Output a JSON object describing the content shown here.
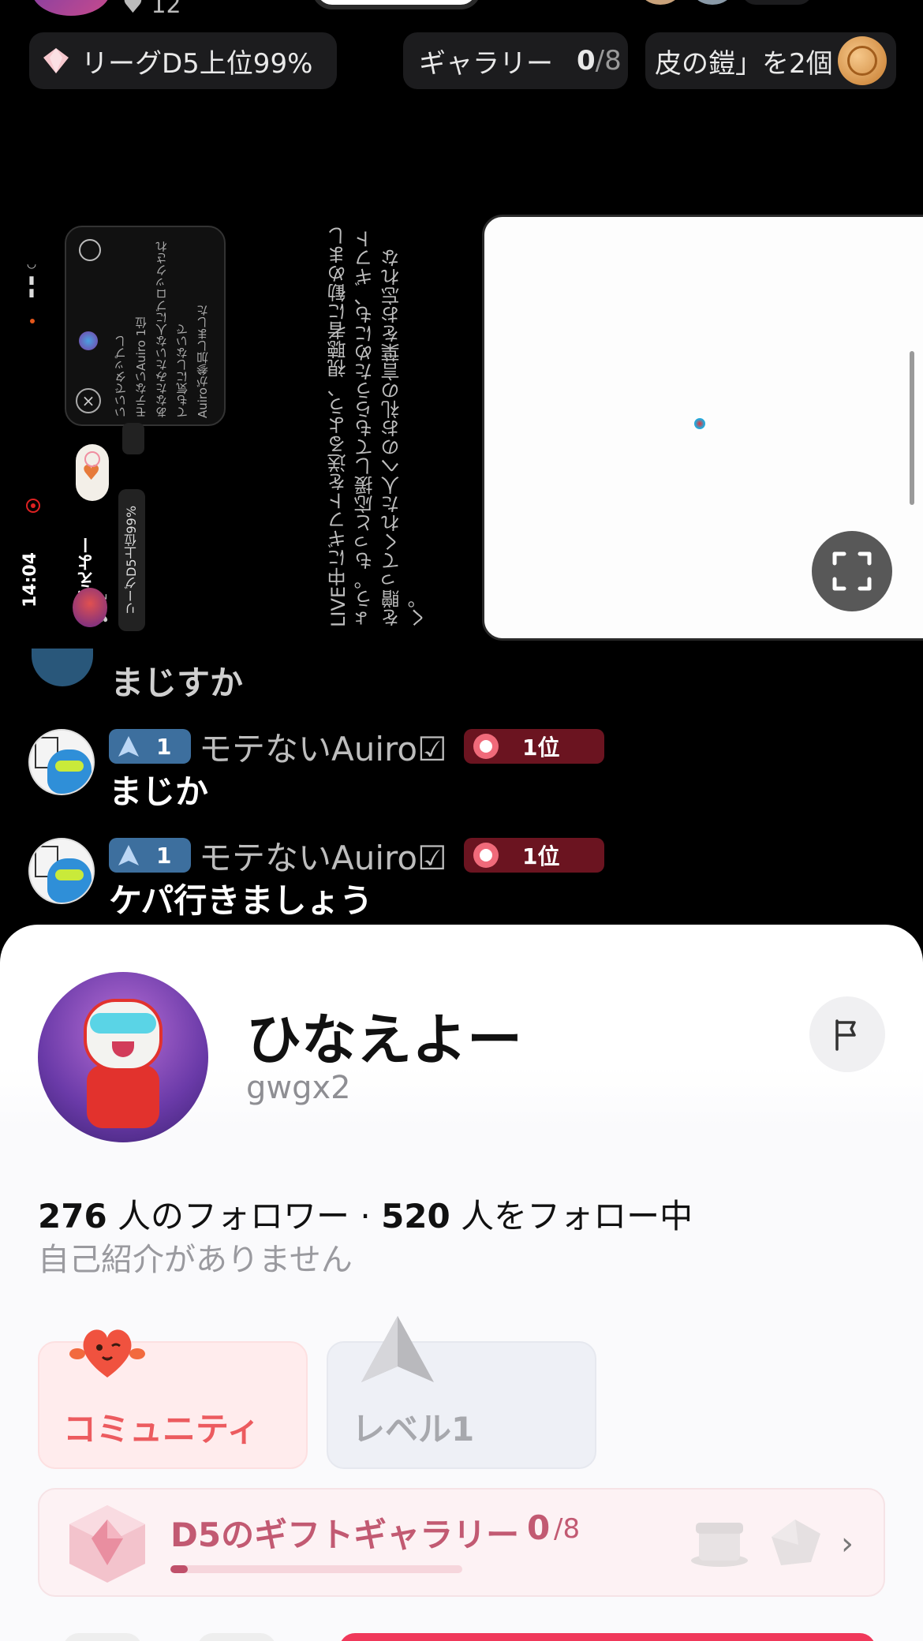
{
  "top": {
    "follower_count_cut": "12",
    "league_chip": "リーグD5上位99%",
    "gallery_chip_label": "ギャラリー",
    "gallery_chip_count": "0",
    "gallery_chip_total": "/8",
    "gift_chip": "皮の鎧」を2個"
  },
  "embedded_screenshot": {
    "time": "14:04",
    "host_name": "ひなえよー",
    "host_likes": "♥ 12",
    "league": "リーグD5上位99%",
    "panel_lines": [
      "いいでタップし",
      "モテないAuiro 1位",
      "あなたみたいな人にブロックされ",
      "ても気にしないで",
      "Auiroが参加しました"
    ],
    "notice": "LIVE中にギフトを送るよう、視聴者に勧めましょう。もっと応援してもらうためにも、ギフトを贈ってくれた人へのお礼の言葉をお忘れなく。"
  },
  "chat": {
    "cut_message": "まじすか",
    "messages": [
      {
        "level": "1",
        "user": "モテないAuiro☑",
        "rank": "1位",
        "text": "まじか"
      },
      {
        "level": "1",
        "user": "モテないAuiro☑",
        "rank": "1位",
        "text": "ケパ行きましょう"
      }
    ]
  },
  "profile": {
    "name": "ひなえよー",
    "handle": "gwgx2",
    "followers": "276",
    "followers_label": " 人のフォロワー · ",
    "following": "520",
    "following_label": " 人をフォロー中",
    "bio": "自己紹介がありません",
    "community_label": "コミュニティ",
    "level_label": "レベル1",
    "gallery_title": "D5のギフトギャラリー",
    "gallery_count": "0",
    "gallery_total": "/8",
    "gallery_progress": 0.06
  },
  "colors": {
    "accent_pink": "#ec5b5f",
    "gallery_pink": "#c25a72",
    "level_badge": "#3d6f9e",
    "rank_badge": "#6b1420"
  },
  "icons": [
    "diamond-icon",
    "coin-icon",
    "fullscreen-icon",
    "flag-icon",
    "paper-plane-level-icon",
    "heart-mascot-icon",
    "gem-box-icon",
    "chevron-right-icon"
  ]
}
